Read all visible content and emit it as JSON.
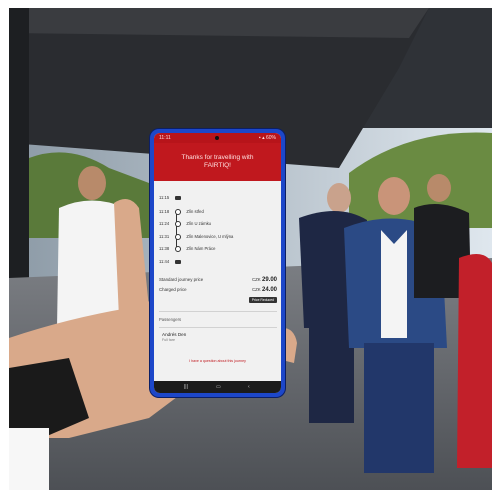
{
  "phone": {
    "status_time": "11:11",
    "status_icons": "▪ ▴ 60%",
    "header": {
      "line1": "Thanks for travelling with",
      "line2": "FAIRTIQ!"
    },
    "stops": [
      {
        "time": "11:15",
        "name": ""
      },
      {
        "time": "11:18",
        "name": "Zlín střed"
      },
      {
        "time": "11:24",
        "name": "Zlín U zámku"
      },
      {
        "time": "11:31",
        "name": "Zlín Malenovice, U mlýna"
      },
      {
        "time": "11:38",
        "name": "Zlín Nám Práce"
      },
      {
        "time": "11:44",
        "name": ""
      }
    ],
    "prices": {
      "standard_label": "Standard journey price",
      "standard_amount": "29.00",
      "cheapest_label": "Charged price",
      "cheapest_amount": "24.00",
      "currency": "CZK",
      "badge": "Price Reduced"
    },
    "passenger": {
      "section": "Passengers",
      "name": "Andrés Den",
      "type": "Full fare"
    },
    "rate_link": "I have a question about this journey",
    "nav_icons": [
      "recent-apps-icon",
      "home-icon",
      "back-icon"
    ]
  },
  "colors": {
    "app_red": "#c0181e",
    "phone_case_blue": "#1d47c9",
    "screen_bg": "#f1f1f1"
  }
}
